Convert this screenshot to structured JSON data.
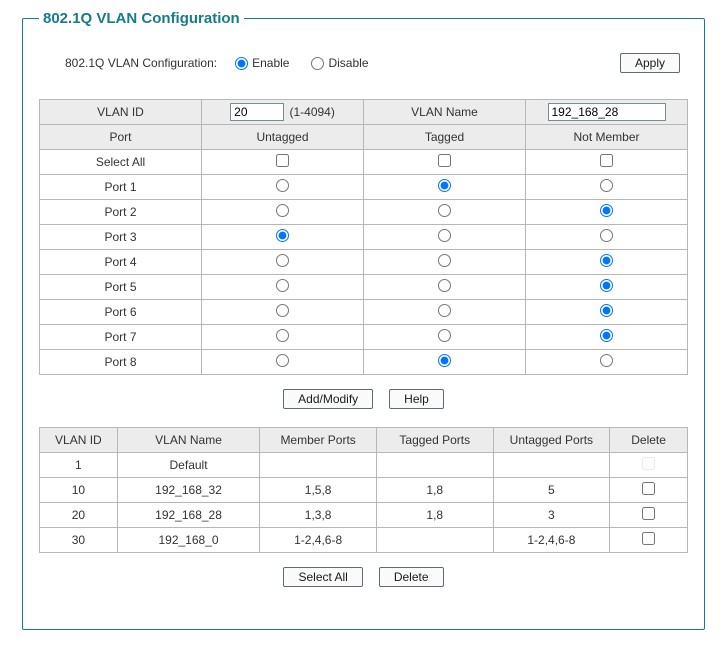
{
  "legend": "802.1Q VLAN Configuration",
  "top": {
    "label": "802.1Q VLAN Configuration:",
    "enable": "Enable",
    "disable": "Disable",
    "selected": "enable",
    "apply": "Apply"
  },
  "cfgHeader": {
    "vlan_id": "VLAN ID",
    "vlan_id_value": "20",
    "vlan_id_range": "(1-4094)",
    "vlan_name": "VLAN Name",
    "vlan_name_value": "192_168_28",
    "port": "Port",
    "untagged": "Untagged",
    "tagged": "Tagged",
    "notmember": "Not Member",
    "select_all": "Select All"
  },
  "ports": [
    {
      "name": "Port 1",
      "sel": "tagged"
    },
    {
      "name": "Port 2",
      "sel": "notmember"
    },
    {
      "name": "Port 3",
      "sel": "untagged"
    },
    {
      "name": "Port 4",
      "sel": "notmember"
    },
    {
      "name": "Port 5",
      "sel": "notmember"
    },
    {
      "name": "Port 6",
      "sel": "notmember"
    },
    {
      "name": "Port 7",
      "sel": "notmember"
    },
    {
      "name": "Port 8",
      "sel": "tagged"
    }
  ],
  "midButtons": {
    "add_modify": "Add/Modify",
    "help": "Help"
  },
  "listHeader": {
    "vlan_id": "VLAN ID",
    "vlan_name": "VLAN Name",
    "member": "Member Ports",
    "tagged": "Tagged Ports",
    "untagged": "Untagged Ports",
    "delete": "Delete"
  },
  "vlans": [
    {
      "id": "1",
      "name": "Default",
      "member": "",
      "tagged": "",
      "untagged": "",
      "deletable": false
    },
    {
      "id": "10",
      "name": "192_168_32",
      "member": "1,5,8",
      "tagged": "1,8",
      "untagged": "5",
      "deletable": true
    },
    {
      "id": "20",
      "name": "192_168_28",
      "member": "1,3,8",
      "tagged": "1,8",
      "untagged": "3",
      "deletable": true
    },
    {
      "id": "30",
      "name": "192_168_0",
      "member": "1-2,4,6-8",
      "tagged": "",
      "untagged": "1-2,4,6-8",
      "deletable": true
    }
  ],
  "bottomButtons": {
    "select_all": "Select All",
    "delete": "Delete"
  }
}
